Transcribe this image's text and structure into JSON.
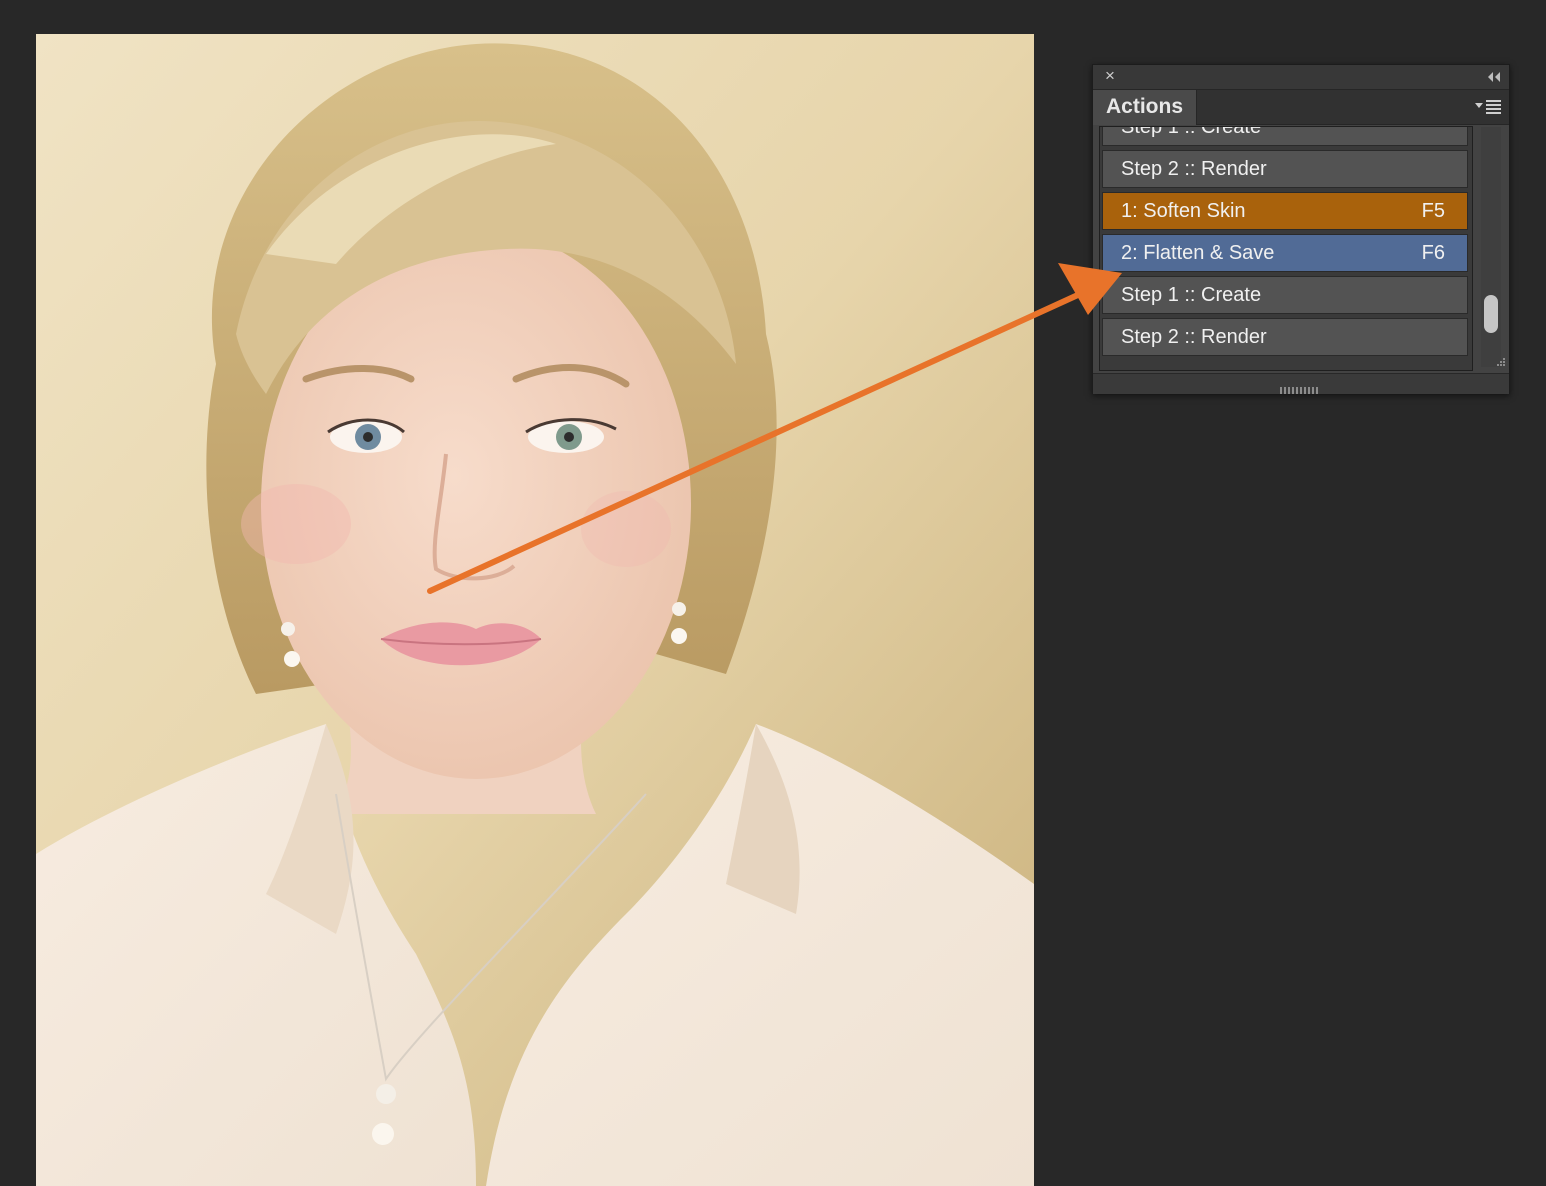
{
  "photo": {
    "icon": "portrait-photo"
  },
  "panel": {
    "tab_label": "Actions",
    "close_icon": "×",
    "rows": [
      {
        "label": "Step 1 :: Create",
        "key": ""
      },
      {
        "label": "Step 2 :: Render",
        "key": ""
      },
      {
        "label": "1: Soften Skin",
        "key": "F5"
      },
      {
        "label": "2: Flatten & Save",
        "key": "F6"
      },
      {
        "label": "Step 1 :: Create",
        "key": ""
      },
      {
        "label": "Step 2 :: Render",
        "key": ""
      }
    ]
  },
  "colors": {
    "background": "#282828",
    "row_default": "#535353",
    "row_highlight_orange": "#a9620c",
    "row_highlight_blue": "#516b96",
    "arrow": "#e8732a"
  }
}
